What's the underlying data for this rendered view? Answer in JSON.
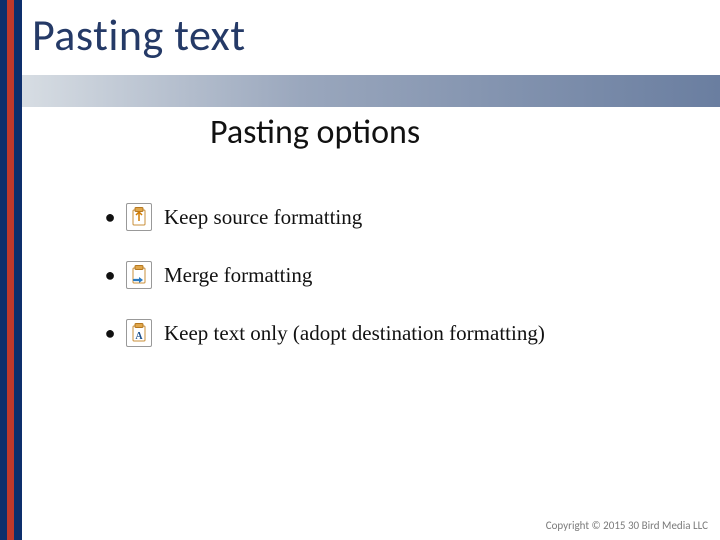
{
  "title": "Pasting text",
  "subtitle": "Pasting options",
  "items": [
    {
      "label": "Keep source formatting"
    },
    {
      "label": "Merge formatting"
    },
    {
      "label": "Keep text only (adopt destination formatting)"
    }
  ],
  "footer": "Copyright © 2015 30 Bird Media LLC",
  "colors": {
    "title": "#253a67",
    "navy": "#0d2f6c",
    "red": "#c0392b"
  }
}
